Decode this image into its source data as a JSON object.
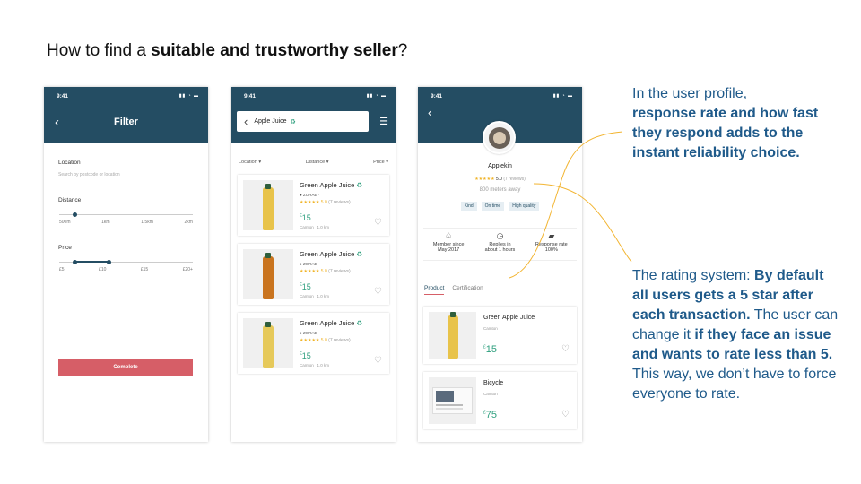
{
  "heading": {
    "plain": "How to find a ",
    "bold": "suitable and trustworthy seller",
    "end": "?"
  },
  "status": {
    "time": "9:41",
    "icons": "▮▮ ◔ ▬"
  },
  "filter_screen": {
    "title": "Filter",
    "location_label": "Location",
    "location_placeholder": "Search by postcode or location",
    "distance_label": "Distance",
    "distance_ticks": [
      "500m",
      "1km",
      "1.5km",
      "2km"
    ],
    "distance_value_fraction": 0.12,
    "price_label": "Price",
    "price_ticks": [
      "£5",
      "£10",
      "£15",
      "£20+"
    ],
    "price_range_fraction": [
      0.12,
      0.37
    ],
    "complete_button": "Complete"
  },
  "results_screen": {
    "search_value": "Apple Juice",
    "search_icon": "♻",
    "dropdowns": [
      "Location ▾",
      "Distance ▾",
      "Price ▾"
    ],
    "cards": [
      {
        "name": "Green Apple Juice",
        "seller": "ZORAE",
        "stars": "★★★★★ 5.0",
        "reviews": "(7 reviews)",
        "currency": "£",
        "price": "15",
        "place": "Camton",
        "distance": "1.0 km",
        "bottle_color": "#e8c34a"
      },
      {
        "name": "Green Apple Juice",
        "seller": "ZORAE",
        "stars": "★★★★★ 5.0",
        "reviews": "(7 reviews)",
        "currency": "£",
        "price": "15",
        "place": "Camton",
        "distance": "1.0 km",
        "bottle_color": "#c9741f"
      },
      {
        "name": "Green Apple Juice",
        "seller": "ZORAE",
        "stars": "★★★★★ 5.0",
        "reviews": "(7 reviews)",
        "currency": "£",
        "price": "15",
        "place": "Camton",
        "distance": "1.0 km",
        "bottle_color": "#e6c95a"
      }
    ]
  },
  "profile_screen": {
    "name": "Applekin",
    "stars": "★★★★★",
    "rating": "5.0",
    "reviews": "(7 reviews)",
    "distance": "800 meters away",
    "tags": [
      "Kind",
      "On time",
      "High quality"
    ],
    "stats": [
      {
        "icon": "♤",
        "line1": "Member since",
        "line2": "May 2017"
      },
      {
        "icon": "◷",
        "line1": "Replies in",
        "line2": "about 1 hours"
      },
      {
        "icon": "▰",
        "line1": "Response rate",
        "line2": "100%"
      }
    ],
    "tabs": [
      "Product",
      "Certification"
    ],
    "products": [
      {
        "name": "Green Apple Juice",
        "place": "Camton",
        "currency": "£",
        "price": "15"
      },
      {
        "name": "Bicycle",
        "place": "Camton",
        "currency": "£",
        "price": "75"
      }
    ]
  },
  "note_top": {
    "line1": "In the user profile,",
    "bold": "response rate and how fast they respond adds to the instant reliability choice."
  },
  "note_bottom": {
    "p1": "The rating system: ",
    "b1": "By default all users gets a 5 star after each transaction.",
    "p2": " The user can change it ",
    "b2": "if they face an issue and wants to rate less than 5.",
    "p3": " This way, we don’t have to force everyone to rate."
  },
  "colors": {
    "header": "#244d63",
    "accent_red": "#d65e67",
    "price_green": "#2e9f7e",
    "note_blue": "#1f5a8a",
    "connector": "#f2b430"
  }
}
